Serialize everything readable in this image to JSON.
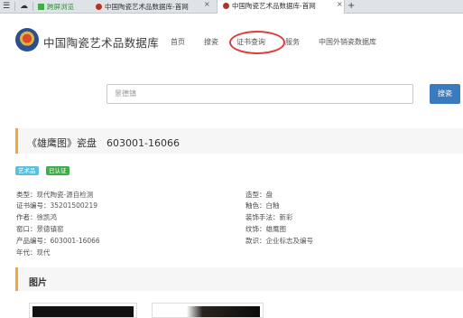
{
  "browser": {
    "tabs": [
      {
        "label": "跨屏浏览"
      },
      {
        "label": "中国陶瓷艺术品数据库-首网"
      },
      {
        "label": "中国陶瓷艺术品数据库-首网"
      }
    ],
    "new_tab": "+",
    "close": "×"
  },
  "header": {
    "site_title": "中国陶瓷艺术品数据库",
    "nav": [
      "首页",
      "搜瓷",
      "证书查询",
      "服务",
      "中国外销瓷数据库"
    ]
  },
  "search": {
    "placeholder": "景德镇",
    "button": "搜瓷"
  },
  "product": {
    "title": "《雄鹰图》瓷盘　603001-16066",
    "badges": [
      {
        "label": "艺术品",
        "color": "#5bc0de"
      },
      {
        "label": "已认证",
        "color": "#3fae49"
      }
    ],
    "details_left": [
      {
        "key": "类型：",
        "value": "现代陶瓷-源自检测"
      },
      {
        "key": "证书编号：",
        "value": "35201500219"
      },
      {
        "key": "作者：",
        "value": "徐凯鸿"
      },
      {
        "key": "窑口：",
        "value": "景德镇窑"
      },
      {
        "key": "产品编号：",
        "value": "603001-16066"
      },
      {
        "key": "年代：",
        "value": "现代"
      }
    ],
    "details_right": [
      {
        "key": "造型：",
        "value": "盘"
      },
      {
        "key": "釉色：",
        "value": "白釉"
      },
      {
        "key": "装饰手法：",
        "value": "新彩"
      },
      {
        "key": "纹饰：",
        "value": "雄鹰图"
      },
      {
        "key": "款识：",
        "value": "企业标志及编号"
      }
    ]
  },
  "pictures": {
    "title": "图片"
  }
}
